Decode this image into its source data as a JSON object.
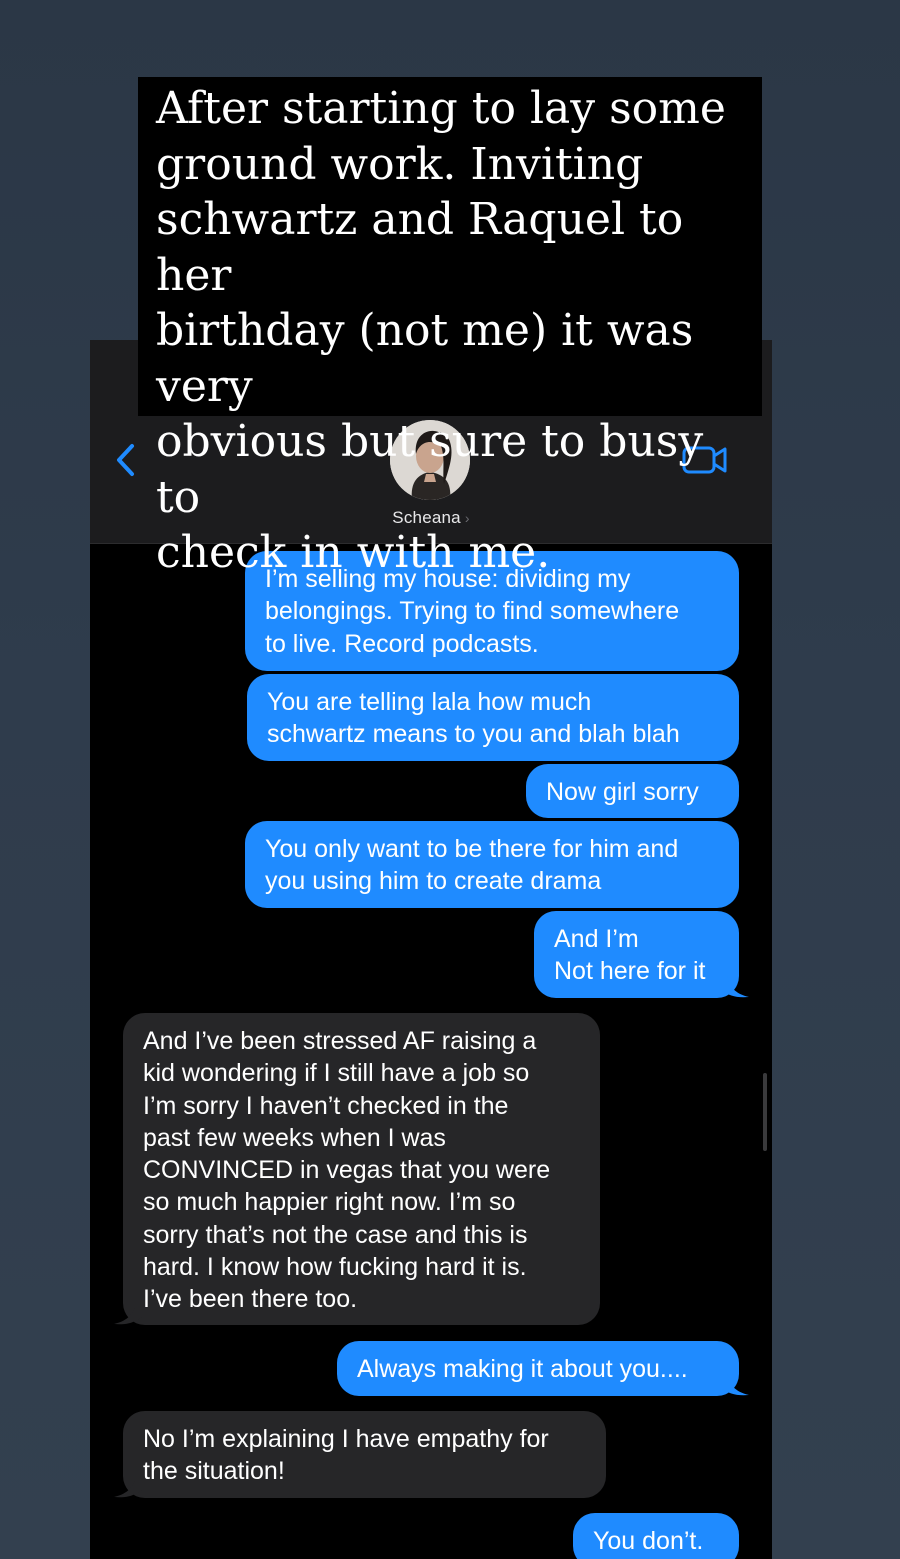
{
  "story_caption": "After starting to lay some\nground work. Inviting\nschwartz and Raquel to her\nbirthday (not me) it was very\nobvious but sure to busy to\ncheck in with me.",
  "header": {
    "contact_name": "Scheana",
    "chevron": "›",
    "back_icon": "chevron-left-icon",
    "video_icon": "video-camera-icon"
  },
  "colors": {
    "outgoing_bubble": "#1f8bff",
    "incoming_bubble": "#262628",
    "accent": "#1f8bff",
    "background": "#000000"
  },
  "messages": [
    {
      "direction": "outgoing",
      "text": "I’m selling my house: dividing my\nbelongings. Trying to find somewhere\nto live. Record podcasts."
    },
    {
      "direction": "outgoing",
      "text": "You are telling lala how much\nschwartz means to you and blah blah"
    },
    {
      "direction": "outgoing",
      "text": "Now girl sorry"
    },
    {
      "direction": "outgoing",
      "text": "You only want to be there for him and\nyou using him to create drama"
    },
    {
      "direction": "outgoing",
      "text": "And I’m\nNot here for it"
    },
    {
      "direction": "incoming",
      "text": "And I’ve been stressed AF raising a\nkid wondering if I still have a job so\nI’m sorry I haven’t checked in the\npast few weeks when I was\nCONVINCED in vegas that you were\nso much happier right now. I’m so\nsorry that’s not the case and this is\nhard. I know how fucking hard it is.\nI’ve been there too."
    },
    {
      "direction": "outgoing",
      "text": "Always making it about you...."
    },
    {
      "direction": "incoming",
      "text": "No I’m explaining I have empathy for\nthe situation!"
    },
    {
      "direction": "outgoing",
      "text": "You don’t."
    }
  ]
}
